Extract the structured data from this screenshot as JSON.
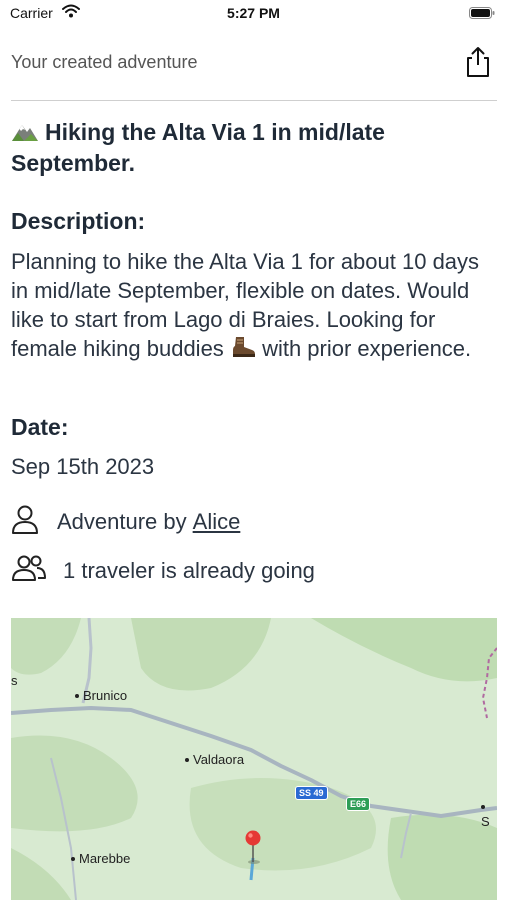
{
  "status": {
    "carrier": "Carrier",
    "time": "5:27 PM"
  },
  "nav": {
    "title": "Your created adventure"
  },
  "adventure": {
    "title": "Hiking the Alta Via 1 in mid/late September.",
    "description_heading": "Description:",
    "description_before": "Planning to hike the Alta Via 1 for about 10 days in mid/late September, flexible on dates. Would like to start from Lago di Braies. Looking for female hiking buddies",
    "description_after": "with prior experience.",
    "date_heading": "Date:",
    "date": "Sep 15th 2023",
    "author_prefix": "Adventure by",
    "author": "Alice",
    "travelers": "1 traveler is already going"
  },
  "map": {
    "labels": {
      "brunico": "Brunico",
      "valdaora": "Valdaora",
      "marebbe": "Marebbe",
      "edge_left": "s",
      "edge_right": "S"
    },
    "shields": {
      "ss49": "SS 49",
      "e66": "E66"
    },
    "colors": {
      "land": "#d8ead1",
      "forest": "#bfdcb2",
      "road": "#a8b5c0",
      "pin": "#e53935",
      "ss_shield": "#2a6ad3",
      "e_shield": "#2e9e57"
    }
  },
  "icons": [
    "wifi-icon",
    "battery-icon",
    "share-icon",
    "mountain-icon",
    "hiking-boot-icon",
    "person-icon",
    "group-icon",
    "map-pin-icon"
  ]
}
